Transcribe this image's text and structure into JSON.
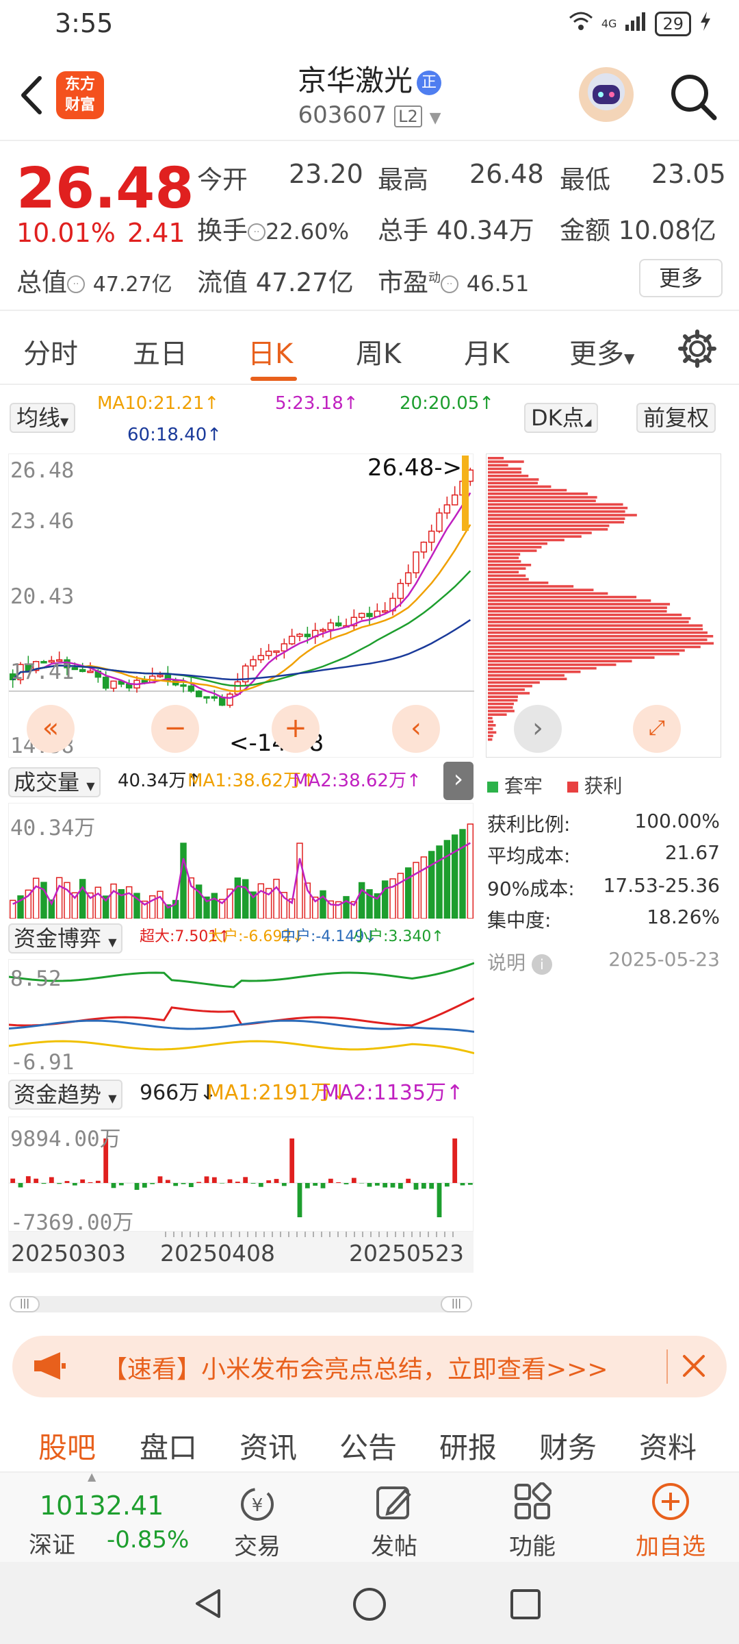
{
  "status": {
    "time": "3:55",
    "network": "4G",
    "battery": "29"
  },
  "header": {
    "logo": "东方\n财富",
    "stock_name": "京华激光",
    "badge": "正",
    "code": "603607",
    "level": "L2"
  },
  "quote": {
    "price": "26.48",
    "change_pct": "10.01%",
    "change": "2.41",
    "open_label": "今开",
    "open": "23.20",
    "high_label": "最高",
    "high": "26.48",
    "low_label": "最低",
    "low": "23.05",
    "turnover_label": "换手",
    "turnover": "22.60%",
    "volume_label": "总手",
    "volume": "40.34万",
    "amount_label": "金额",
    "amount": "10.08亿",
    "mktcap_label": "总值",
    "mktcap": "47.27亿",
    "float_label": "流值",
    "float": "47.27亿",
    "pe_label": "市盈",
    "pe_sup": "动",
    "pe": "46.51",
    "more": "更多"
  },
  "tabs": [
    "分时",
    "五日",
    "日K",
    "周K",
    "月K",
    "更多"
  ],
  "active_tab": "日K",
  "kline": {
    "ma_selector": "均线",
    "ma10": "MA10:21.21↑",
    "ma5": "5:23.18↑",
    "ma20": "20:20.05↑",
    "ma60": "60:18.40↑",
    "dk": "DK点",
    "adjust": "前复权",
    "y_labels": [
      "26.48",
      "23.46",
      "20.43",
      "17.41",
      "14.38"
    ],
    "high_marker": "26.48->",
    "low_marker": "<-14.38",
    "buttons": [
      "«",
      "−",
      "+",
      "‹"
    ]
  },
  "volume": {
    "selector": "成交量",
    "value": "40.34万↑",
    "ma1": "MA1:38.62万↑",
    "ma2": "MA2:38.62万↑",
    "y_top": "40.34万"
  },
  "fund_game": {
    "selector": "资金博弈",
    "super": "超大:7.501↑",
    "big": "大户:-6.692↓",
    "mid": "中户:-4.149↓",
    "small": "小户:3.340↑",
    "y_top": "8.52",
    "y_bottom": "-6.91"
  },
  "fund_trend": {
    "selector": "资金趋势",
    "value": "966万↓",
    "ma1": "MA1:2191万↓",
    "ma2": "MA2:1135万↑",
    "y_top": "9894.00万",
    "y_bottom": "-7369.00万"
  },
  "dates": [
    "20250303",
    "20250408",
    "20250523"
  ],
  "chips": {
    "legend_trapped": "套牢",
    "legend_profit": "获利",
    "rows": [
      {
        "label": "获利比例:",
        "value": "100.00%"
      },
      {
        "label": "平均成本:",
        "value": "21.67"
      },
      {
        "label": "90%成本:",
        "value": "17.53-25.36"
      },
      {
        "label": "集中度:",
        "value": "18.26%"
      }
    ],
    "note": "说明",
    "date": "2025-05-23"
  },
  "banner": {
    "text": "【速看】小米发布会亮点总结，立即查看>>>"
  },
  "bottom_tabs": [
    "股吧",
    "盘口",
    "资讯",
    "公告",
    "研报",
    "财务",
    "资料"
  ],
  "bottom_bar": {
    "index_value": "10132.41",
    "index_name": "深证",
    "index_change": "-0.85%",
    "trade": "交易",
    "post": "发帖",
    "function": "功能",
    "add": "加自选"
  },
  "colors": {
    "up": "#e0201f",
    "down": "#1d9e2e",
    "accent": "#e8601c",
    "ma5": "#c020c0",
    "ma10": "#f0a000",
    "ma20": "#1d9e2e",
    "ma60": "#1a3a9a"
  }
}
